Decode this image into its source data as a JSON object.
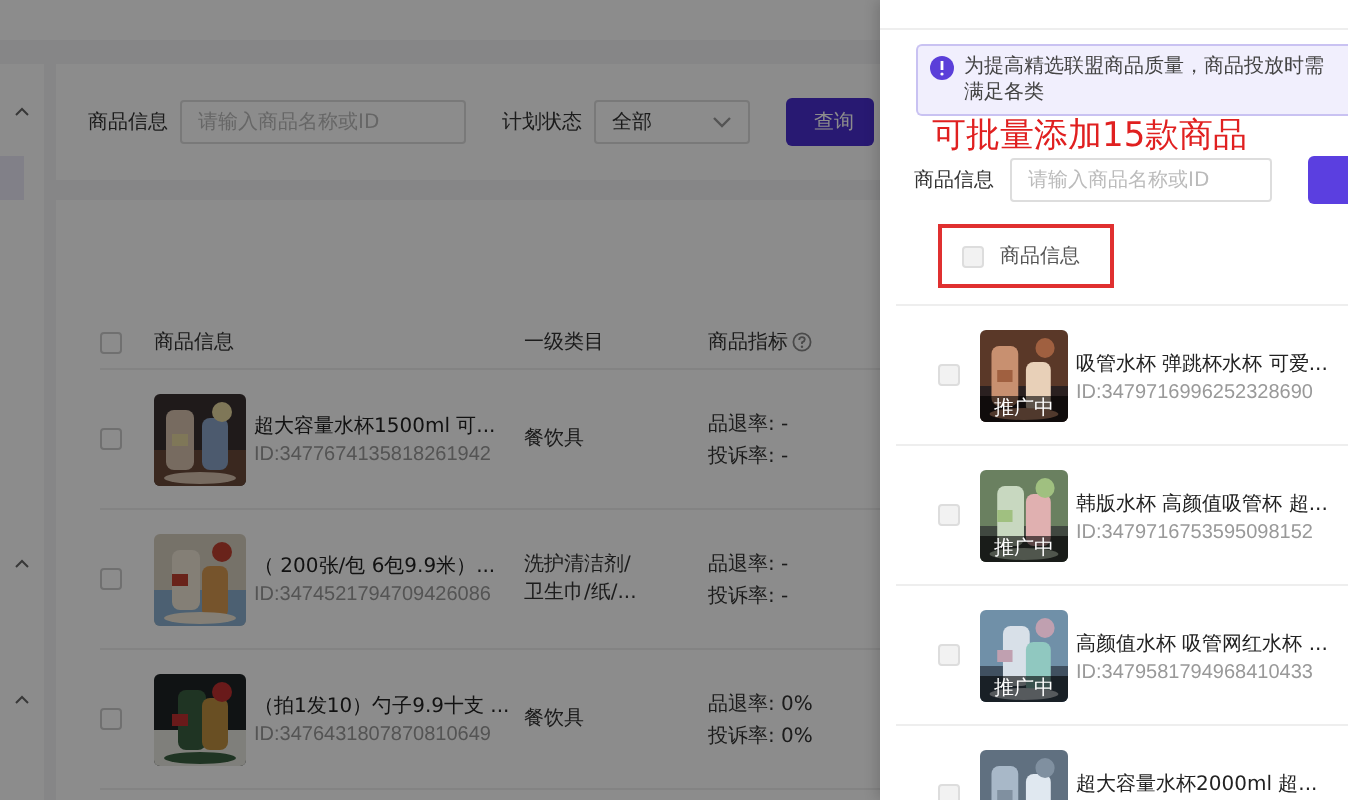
{
  "page": {
    "sidebar": {
      "items": [
        {
          "kind": "chevron"
        },
        {
          "kind": "highlight"
        },
        {
          "kind": "chevron"
        },
        {
          "kind": "chevron"
        }
      ]
    },
    "filter": {
      "product_label": "商品信息",
      "product_placeholder": "请输入商品名称或ID",
      "status_label": "计划状态",
      "status_value": "全部",
      "query_button": "查询"
    },
    "table": {
      "header_checked": false,
      "columns": [
        "商品信息",
        "一级类目",
        "商品指标"
      ],
      "rows": [
        {
          "title": "超大容量水杯1500ml 可...",
          "id": "ID:3477674135818261942",
          "category": "餐饮具",
          "metrics": [
            "品退率: -",
            "投诉率: -"
          ],
          "checked": false
        },
        {
          "title": "（  200张/包 6包9.9米）...",
          "id": "ID:3474521794709426086",
          "category": "洗护清洁剂/\n卫生巾/纸/...",
          "metrics": [
            "品退率: -",
            "投诉率: -"
          ],
          "checked": false
        },
        {
          "title": "（拍1发10）勺子9.9十支 ...",
          "id": "ID:3476431807870810649",
          "category": "餐饮具",
          "metrics": [
            "品退率: 0%",
            "投诉率: 0%"
          ],
          "checked": false
        }
      ]
    }
  },
  "drawer": {
    "notice": "为提高精选联盟商品质量，商品投放时需满足各类",
    "annotation": "可批量添加15款商品",
    "filter": {
      "label": "商品信息",
      "placeholder": "请输入商品名称或ID"
    },
    "header": {
      "label": "商品信息",
      "checked": false
    },
    "items": [
      {
        "title": "吸管水杯 弹跳杯水杯 可爱...",
        "id": "ID:3479716996252328690",
        "badge": "推广中",
        "checked": false
      },
      {
        "title": "韩版水杯 高颜值吸管杯 超...",
        "id": "ID:3479716753595098152",
        "badge": "推广中",
        "checked": false
      },
      {
        "title": "高颜值水杯 吸管网红水杯 ...",
        "id": "ID:3479581794968410433",
        "badge": "推广中",
        "checked": false
      },
      {
        "title": "超大容量水杯2000ml 超...",
        "checked": false
      }
    ]
  }
}
